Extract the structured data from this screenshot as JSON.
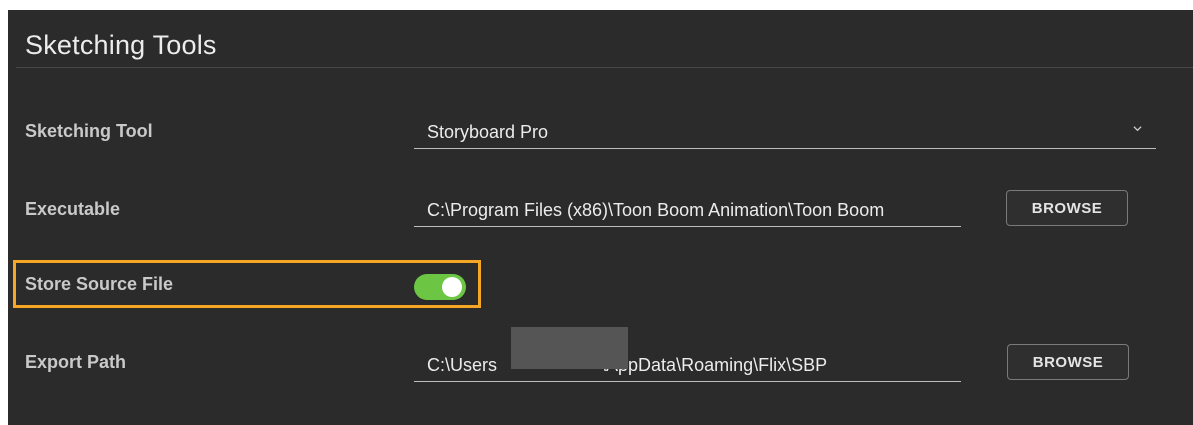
{
  "section": {
    "title": "Sketching Tools"
  },
  "sketching_tool": {
    "label": "Sketching Tool",
    "value": "Storyboard Pro"
  },
  "executable": {
    "label": "Executable",
    "value": "C:\\Program Files (x86)\\Toon Boom Animation\\Toon Boom",
    "browse_label": "BROWSE"
  },
  "store_source": {
    "label": "Store Source File",
    "enabled": true
  },
  "export_path": {
    "label": "Export Path",
    "value_prefix": "C:\\Users",
    "value_suffix": "\\AppData\\Roaming\\Flix\\SBP",
    "browse_label": "BROWSE"
  },
  "colors": {
    "panel_bg": "#2b2b2b",
    "toggle_on": "#6cc644",
    "highlight": "#f5a623"
  },
  "icons": {
    "dropdown": "chevron-down-icon",
    "toggle_knob": "toggle-knob"
  }
}
